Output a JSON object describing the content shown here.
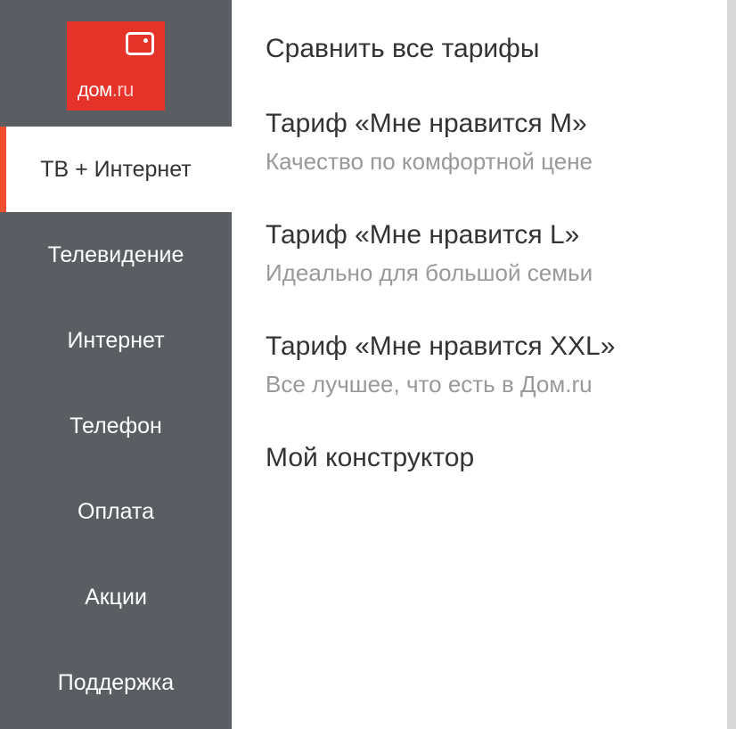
{
  "logo": {
    "text_main": "дом",
    "text_suffix": ".ru"
  },
  "sidebar": {
    "items": [
      {
        "label": "ТВ + Интернет",
        "active": true
      },
      {
        "label": "Телевидение",
        "active": false
      },
      {
        "label": "Интернет",
        "active": false
      },
      {
        "label": "Телефон",
        "active": false
      },
      {
        "label": "Оплата",
        "active": false
      },
      {
        "label": "Акции",
        "active": false
      },
      {
        "label": "Поддержка",
        "active": false
      }
    ]
  },
  "content": {
    "items": [
      {
        "title": "Сравнить все тарифы",
        "subtitle": ""
      },
      {
        "title": "Тариф «Мне нравится M»",
        "subtitle": "Качество по комфортной цене"
      },
      {
        "title": "Тариф «Мне нравится L»",
        "subtitle": "Идеально для большой семьи"
      },
      {
        "title": "Тариф «Мне нравится XXL»",
        "subtitle": "Все лучшее, что есть в Дом.ru"
      },
      {
        "title": "Мой конструктор",
        "subtitle": ""
      }
    ]
  }
}
